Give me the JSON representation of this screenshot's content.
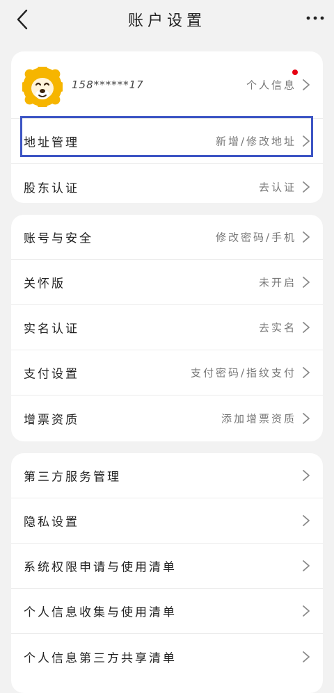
{
  "header": {
    "title": "账户设置",
    "back_icon": "chevron-left-icon",
    "more_icon": "more-horizontal-icon"
  },
  "profile": {
    "phone": "158******17",
    "info_label": "个人信息",
    "has_notification": true,
    "notification_color": "#e60012"
  },
  "sections": [
    {
      "rows": [
        {
          "label": "地址管理",
          "value": "新增/修改地址"
        },
        {
          "label": "股东认证",
          "value": "去认证"
        }
      ]
    },
    {
      "rows": [
        {
          "label": "账号与安全",
          "value": "修改密码/手机"
        },
        {
          "label": "关怀版",
          "value": "未开启"
        },
        {
          "label": "实名认证",
          "value": "去实名"
        },
        {
          "label": "支付设置",
          "value": "支付密码/指纹支付"
        },
        {
          "label": "增票资质",
          "value": "添加增票资质"
        }
      ]
    },
    {
      "rows": [
        {
          "label": "第三方服务管理",
          "value": ""
        },
        {
          "label": "隐私设置",
          "value": ""
        },
        {
          "label": "系统权限申请与使用清单",
          "value": ""
        },
        {
          "label": "个人信息收集与使用清单",
          "value": ""
        },
        {
          "label": "个人信息第三方共享清单",
          "value": ""
        }
      ]
    }
  ],
  "colors": {
    "background": "#f2f2f2",
    "card": "#ffffff",
    "highlight": "#3d55c4",
    "avatar_mane": "#f6b500"
  }
}
